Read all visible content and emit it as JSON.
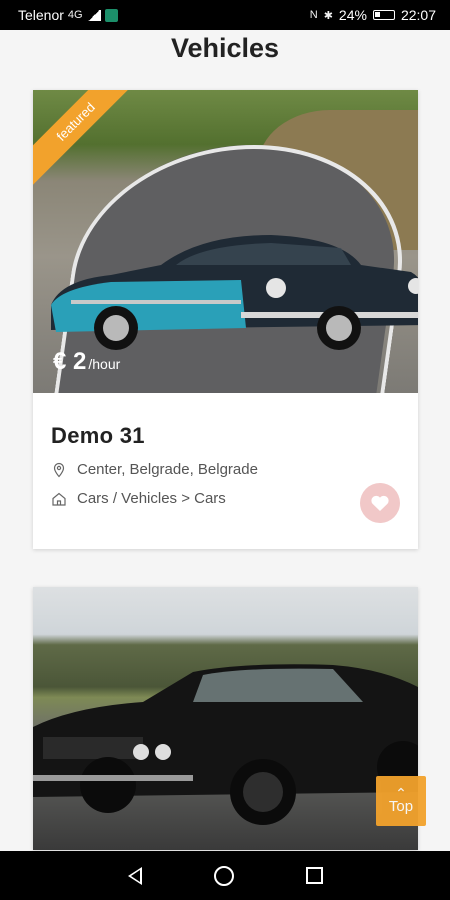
{
  "status_bar": {
    "carrier": "Telenor",
    "network": "4G",
    "battery": "24%",
    "time": "22:07"
  },
  "header": {
    "title": "Vehicles"
  },
  "listings": [
    {
      "badge": "featured",
      "price_amount": "€ 2",
      "price_unit": "/hour",
      "title": "Demo 31",
      "location": "Center, Belgrade, Belgrade",
      "category": "Cars / Vehicles > Cars",
      "icons": {
        "location": "map-pin-icon",
        "category": "home-icon",
        "favorite": "heart-icon"
      }
    },
    {
      "title": ""
    }
  ],
  "scroll_top_button": {
    "label": "Top"
  },
  "colors": {
    "accent": "#f2a22c",
    "favorite_bg": "#f1c8c8",
    "favorite_icon": "#ffffff",
    "text_primary": "#222222",
    "text_secondary": "#555555"
  }
}
